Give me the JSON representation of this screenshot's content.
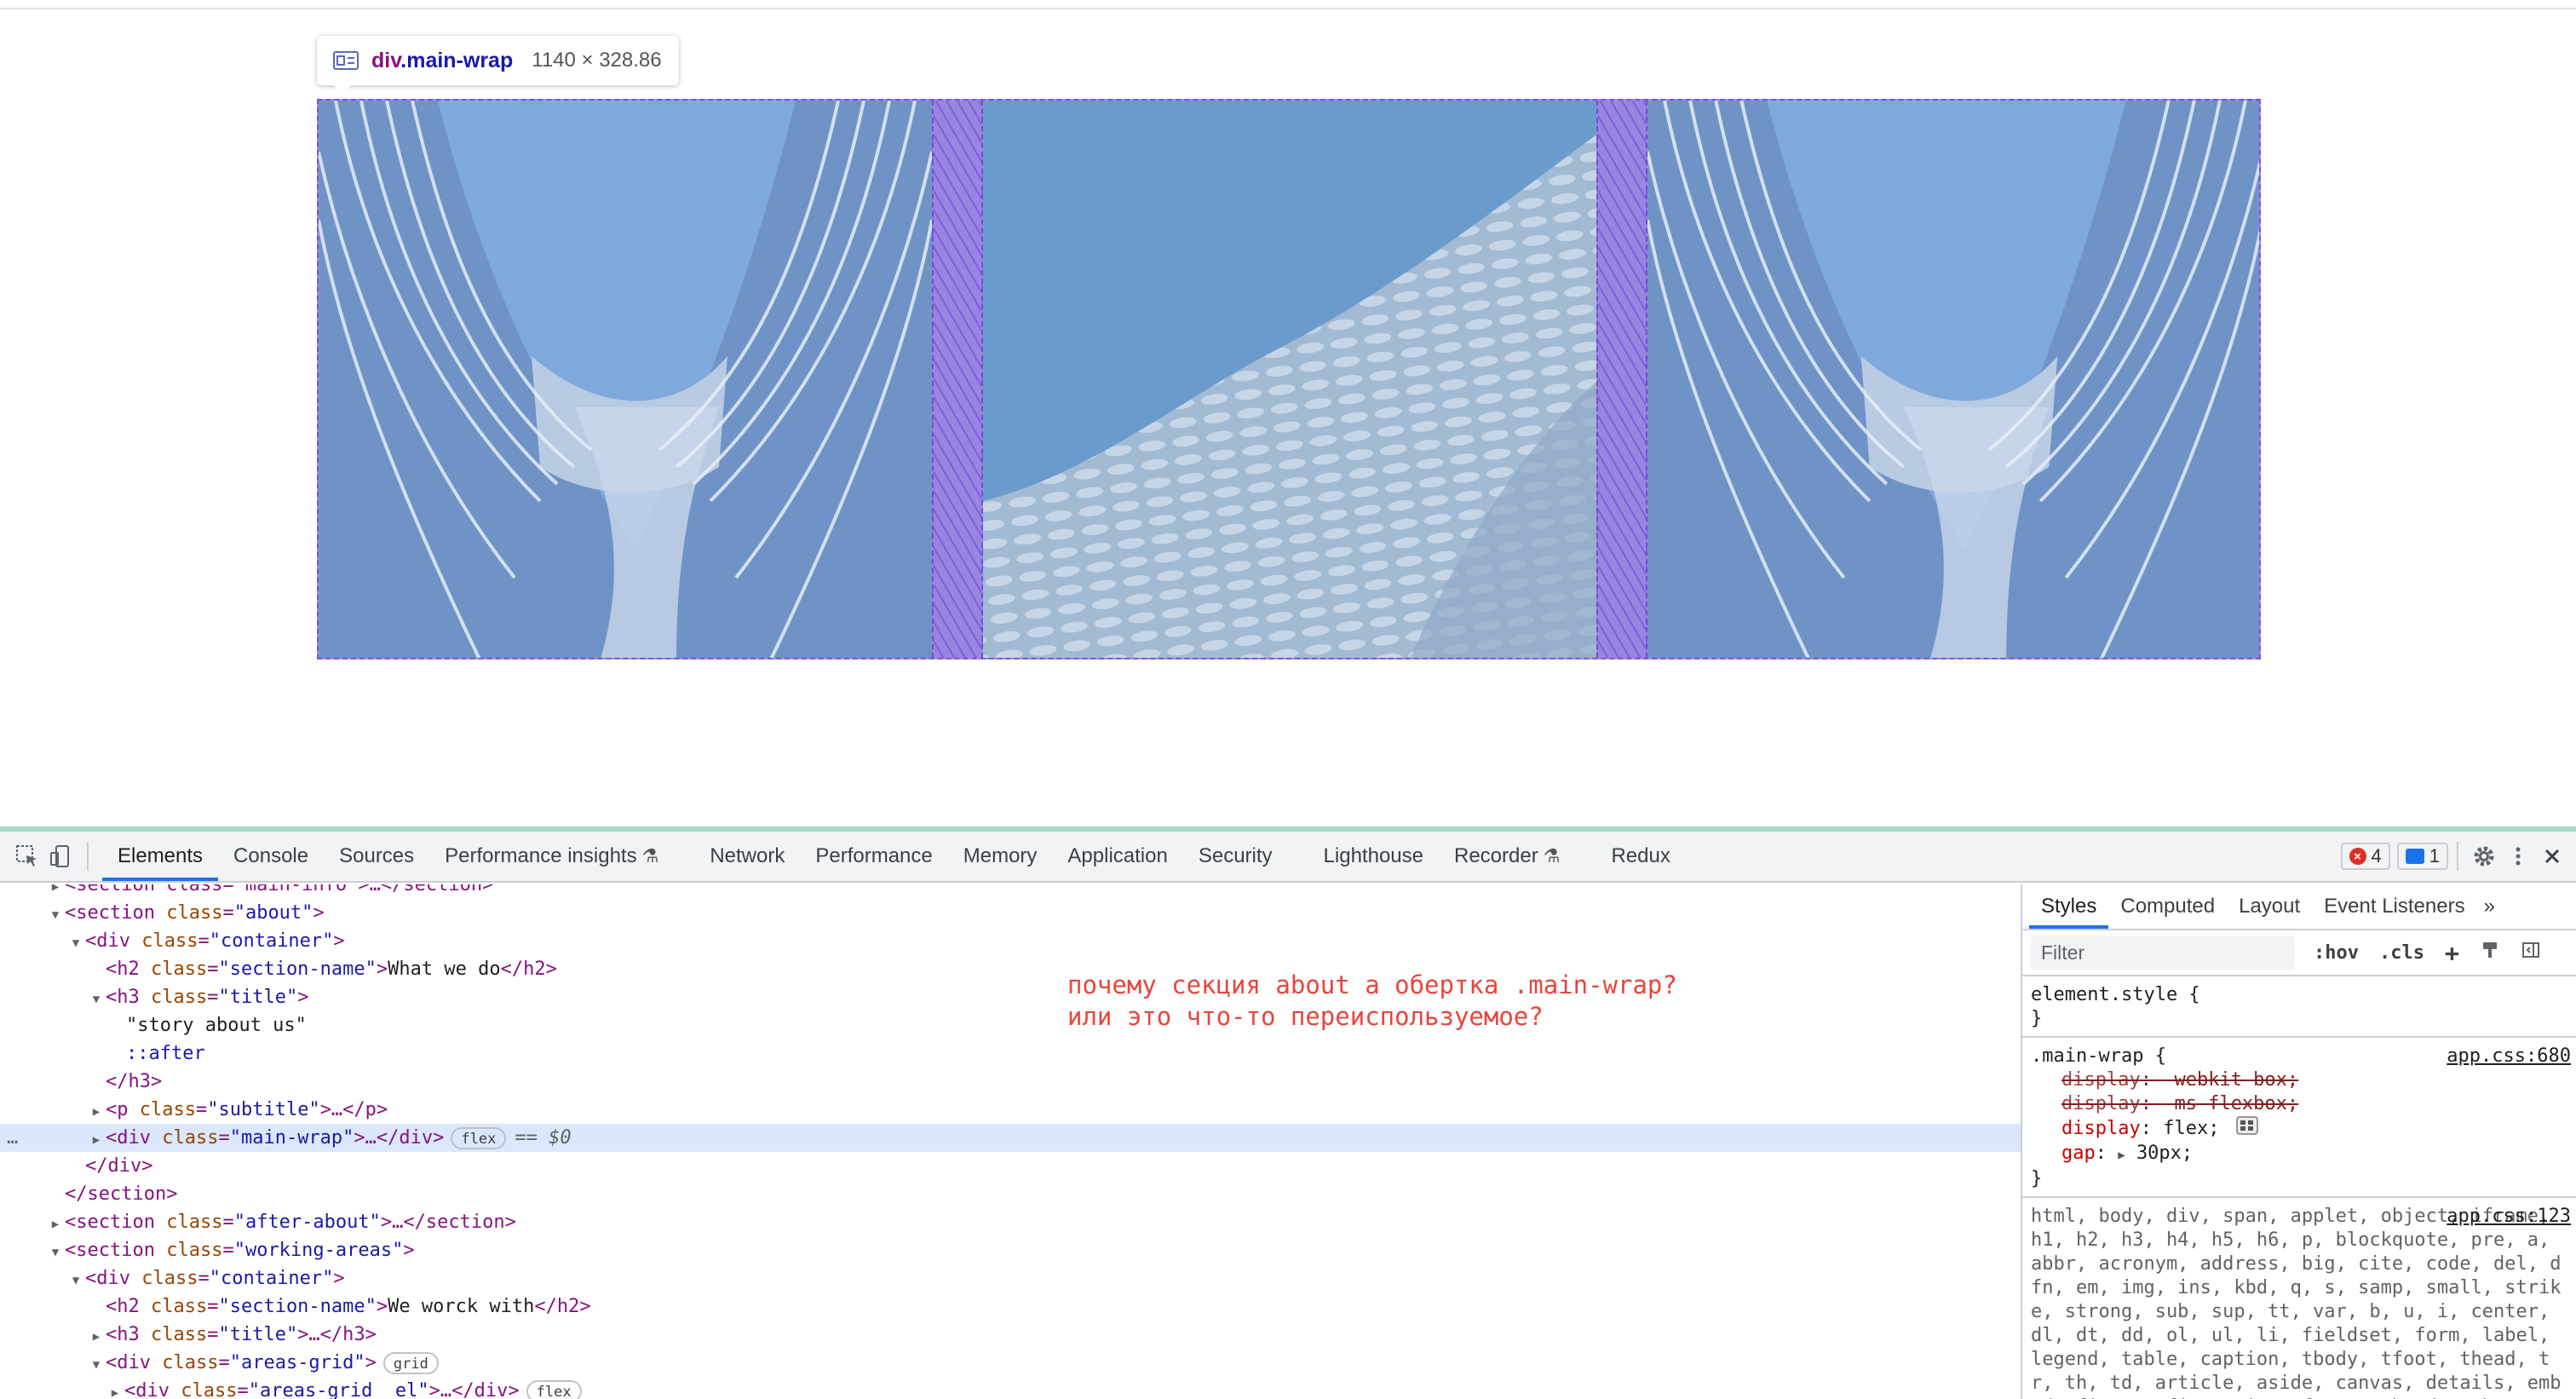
{
  "highlight": {
    "tag": "div",
    "class": ".main-wrap",
    "size": "1140 × 328.86"
  },
  "devtools": {
    "tabs": [
      {
        "label": "Elements",
        "active": true
      },
      {
        "label": "Console"
      },
      {
        "label": "Sources"
      },
      {
        "label": "Performance insights",
        "experimental": true
      },
      {
        "label": "Network"
      },
      {
        "label": "Performance"
      },
      {
        "label": "Memory"
      },
      {
        "label": "Application"
      },
      {
        "label": "Security"
      },
      {
        "label": "Lighthouse"
      },
      {
        "label": "Recorder",
        "experimental": true
      },
      {
        "label": "Redux"
      }
    ],
    "error_count": "4",
    "message_count": "1"
  },
  "elements": {
    "selected_flex_badge": "flex",
    "selected_marker": "== $0",
    "grid_badge": "grid",
    "flex_badge": "flex",
    "dots": "…",
    "lines": {
      "l0": "<section class=\"main-info\">…</section>",
      "l1_tag": "<section",
      "l1_attr": "class",
      "l1_val": "\"about\"",
      "l2_attr": "class",
      "l2_val": "\"container\"",
      "l3_val": "\"section-name\"",
      "l3_text": "What we do",
      "l4_val": "\"title\"",
      "l5_text": "\"story about us\"",
      "l6_text": "::after",
      "l8_val": "\"subtitle\"",
      "l9_val": "\"main-wrap\"",
      "l12_val": "\"after-about\"",
      "l13_val": "\"working-areas\"",
      "l14_val": "\"container\"",
      "l15_val": "\"section-name\"",
      "l15_text": "We worck with",
      "l16_val": "\"title\"",
      "l17_val": "\"areas-grid\"",
      "l18_val": "\"areas-grid__el\""
    }
  },
  "note": {
    "line1": "почему секция about а обертка .main-wrap?",
    "line2": "или это что-то переиспользуемое?"
  },
  "styles": {
    "tabs": [
      "Styles",
      "Computed",
      "Layout",
      "Event Listeners"
    ],
    "filter_placeholder": "Filter",
    "hov": ":hov",
    "cls": ".cls",
    "element_style": "element.style {",
    "close_brace": "}",
    "rule1": {
      "selector": ".main-wrap {",
      "source": "app.css:680",
      "props": [
        {
          "name": "display",
          "value": "-webkit-box;",
          "struck": true
        },
        {
          "name": "display",
          "value": "-ms-flexbox;",
          "struck": true
        },
        {
          "name": "display",
          "value": "flex;"
        },
        {
          "name": "gap",
          "value": "30px;"
        }
      ]
    },
    "rule2": {
      "source": "app.css:123",
      "selectors": "html, body, div, span, applet, object, iframe, h1, h2, h3, h4, h5, h6, p, blockquote, pre, a, abbr, acronym, address, big, cite, code, del, dfn, em, img, ins, kbd, q, s, samp, small, strike, strong, sub, sup, tt, var, b, u, i, center, dl, dt, dd, ol, ul, li, fieldset, form, label, legend, table, caption, tbody, tfoot, thead, tr, th, td, article, aside, canvas, details, embed, figure, figcaption, footer, header, hgroup, menu, nav,"
    }
  },
  "colors": {
    "highlight_border": "#7b52e0",
    "gap_fill": "#9a84e2",
    "image_tint": "#7ea8d8",
    "note_red": "#e8453c",
    "active_tab": "#1a73e8"
  }
}
